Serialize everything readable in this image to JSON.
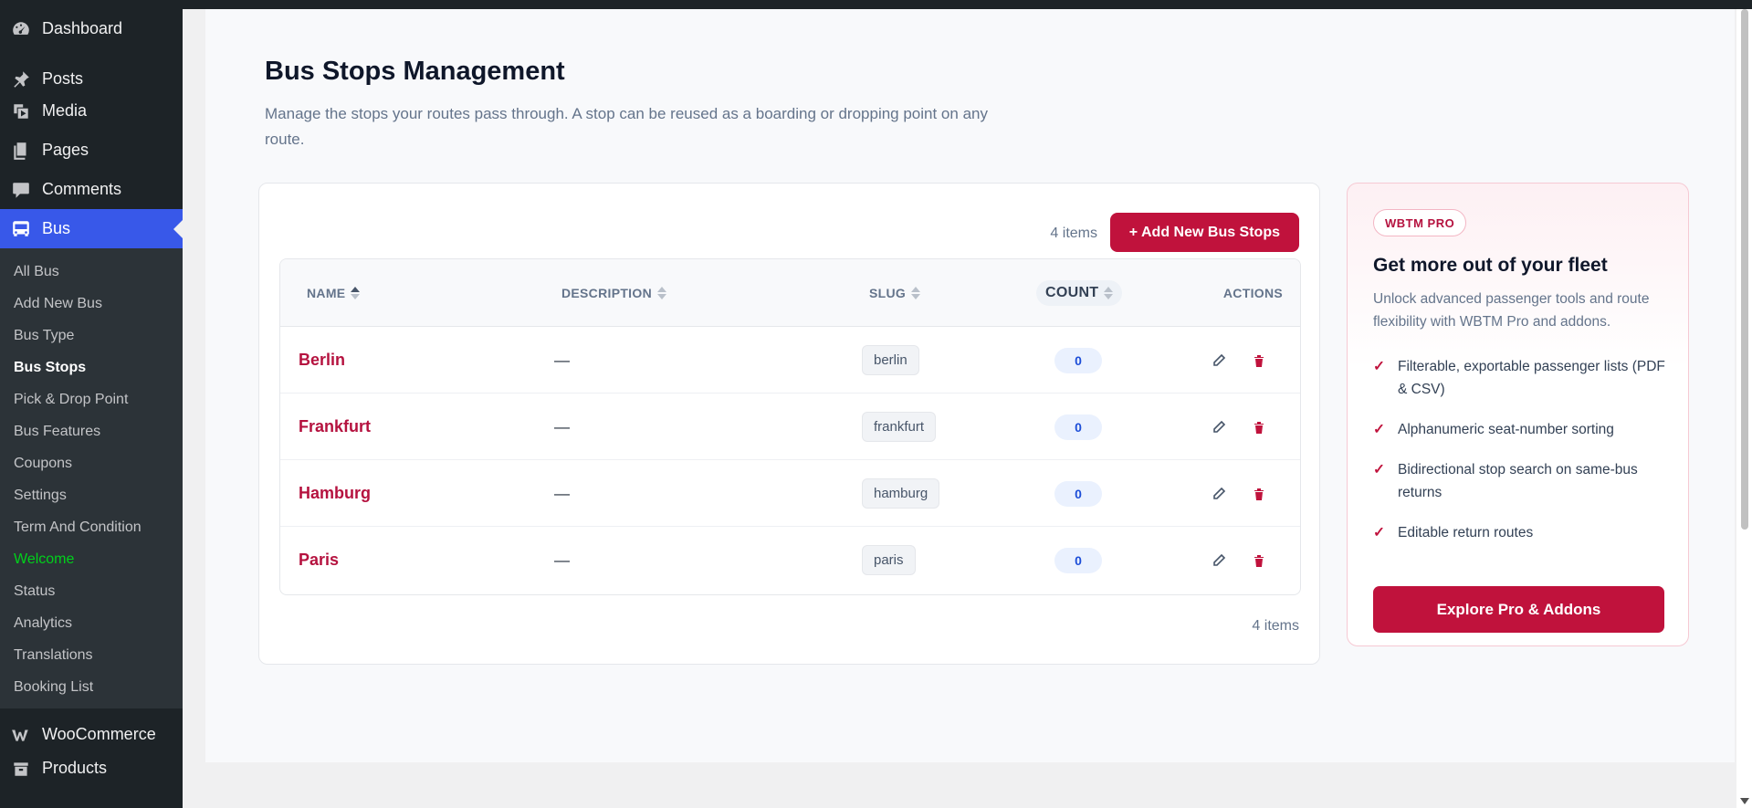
{
  "sidebar": {
    "top_items": [
      {
        "label": "Dashboard",
        "icon": "dashboard-icon"
      },
      {
        "label": "Posts",
        "icon": "pin-icon"
      },
      {
        "label": "Media",
        "icon": "media-icon"
      },
      {
        "label": "Pages",
        "icon": "pages-icon"
      },
      {
        "label": "Comments",
        "icon": "comment-icon"
      },
      {
        "label": "Bus",
        "icon": "bus-icon"
      }
    ],
    "bus_submenu": [
      "All Bus",
      "Add New Bus",
      "Bus Type",
      "Bus Stops",
      "Pick & Drop Point",
      "Bus Features",
      "Coupons",
      "Settings",
      "Term And Condition",
      "Welcome",
      "Status",
      "Analytics",
      "Translations",
      "Booking List"
    ],
    "bottom_items": [
      {
        "label": "WooCommerce",
        "icon": "woocommerce-icon"
      },
      {
        "label": "Products",
        "icon": "products-icon"
      }
    ],
    "active_sub": "Bus Stops",
    "highlight_color": "#3858e9",
    "welcome_color": "#00d11b"
  },
  "page": {
    "title": "Bus Stops Management",
    "description": "Manage the stops your routes pass through. A stop can be reused as a boarding or dropping point on any route."
  },
  "table": {
    "items_count_label": "4 items",
    "add_button_label": "+ Add New Bus Stops",
    "columns": [
      "NAME",
      "DESCRIPTION",
      "SLUG",
      "COUNT",
      "ACTIONS"
    ],
    "rows": [
      {
        "name": "Berlin",
        "description": "—",
        "slug": "berlin",
        "count": "0"
      },
      {
        "name": "Frankfurt",
        "description": "—",
        "slug": "frankfurt",
        "count": "0"
      },
      {
        "name": "Hamburg",
        "description": "—",
        "slug": "hamburg",
        "count": "0"
      },
      {
        "name": "Paris",
        "description": "—",
        "slug": "paris",
        "count": "0"
      }
    ],
    "accent_color": "#c0123c"
  },
  "pro": {
    "badge": "WBTM PRO",
    "title": "Get more out of your fleet",
    "text": "Unlock advanced passenger tools and route flexibility with WBTM Pro and addons.",
    "features": [
      "Filterable, exportable passenger lists (PDF & CSV)",
      "Alphanumeric seat-number sorting",
      "Bidirectional stop search on same-bus returns",
      "Editable return routes"
    ],
    "check_mark": "✓",
    "button_label": "Explore Pro & Addons"
  }
}
